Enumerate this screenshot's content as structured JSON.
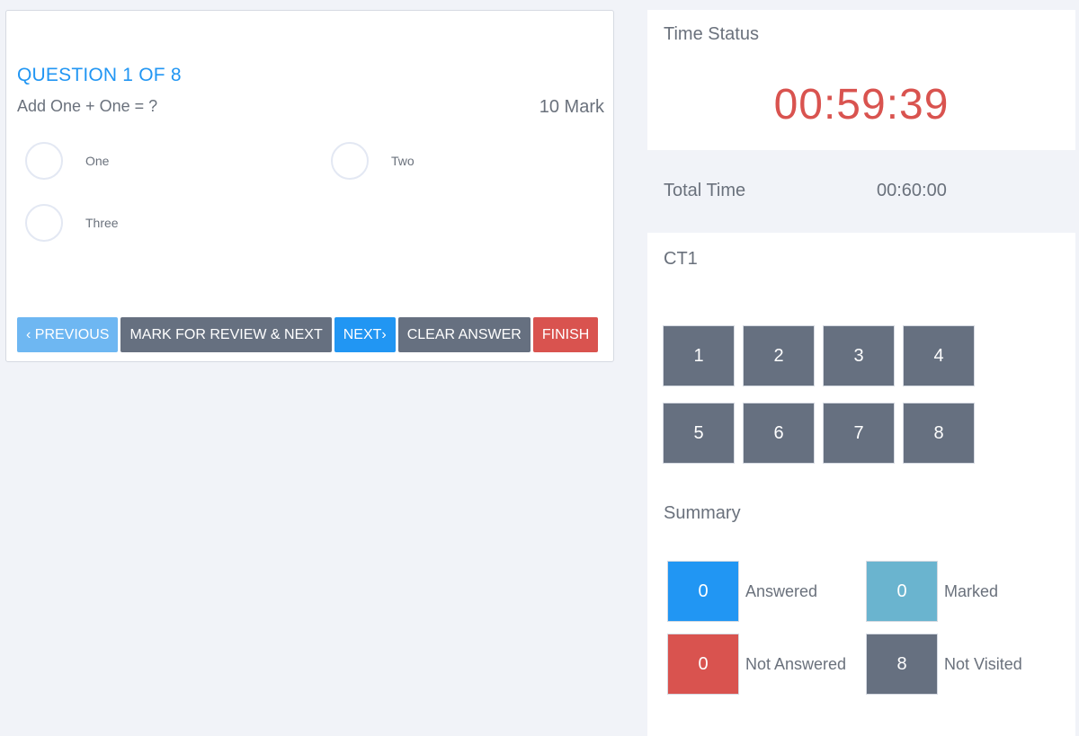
{
  "question": {
    "heading": "QUESTION 1 OF 8",
    "text": "Add One + One = ?",
    "mark": "10 Mark",
    "options": [
      {
        "label": "One"
      },
      {
        "label": "Two"
      },
      {
        "label": "Three"
      }
    ]
  },
  "actions": {
    "previous": "‹ PREVIOUS",
    "mark_review_next": "MARK FOR REVIEW & NEXT",
    "next": "NEXT›",
    "clear_answer": "CLEAR ANSWER",
    "finish": "FINISH"
  },
  "time_status": {
    "title": "Time Status",
    "remaining": "00:59:39",
    "total_label": "Total Time",
    "total_value": "00:60:00"
  },
  "navigator": {
    "exam_name": "CT1",
    "questions": [
      "1",
      "2",
      "3",
      "4",
      "5",
      "6",
      "7",
      "8"
    ]
  },
  "summary": {
    "title": "Summary",
    "answered": {
      "count": "0",
      "label": "Answered"
    },
    "marked": {
      "count": "0",
      "label": "Marked"
    },
    "not_answered": {
      "count": "0",
      "label": "Not Answered"
    },
    "not_visited": {
      "count": "8",
      "label": "Not Visited"
    }
  },
  "colors": {
    "primary": "#2196f3",
    "primary_light": "#6eb7f2",
    "danger": "#d9534f",
    "neutral": "#667080",
    "info": "#6ab4cf",
    "background": "#f1f3f8"
  }
}
